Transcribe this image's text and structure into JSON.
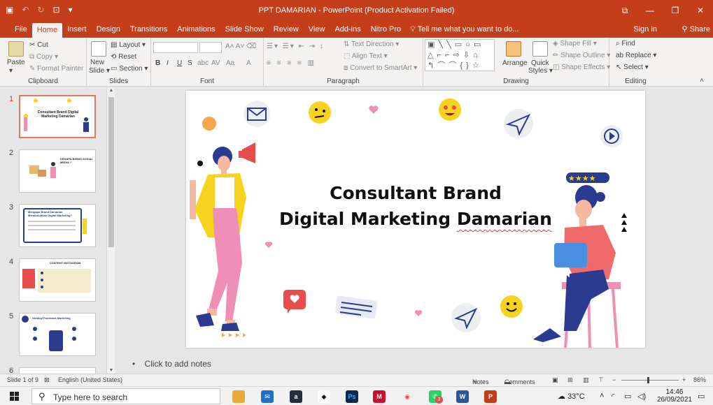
{
  "window": {
    "title": "PPT DAMARIAN  -  PowerPoint (Product Activation Failed)",
    "sign_in": "Sign in",
    "share": "Share"
  },
  "tabs": [
    "File",
    "Home",
    "Insert",
    "Design",
    "Transitions",
    "Animations",
    "Slide Show",
    "Review",
    "View",
    "Add-ins",
    "Nitro Pro"
  ],
  "active_tab": "Home",
  "tell_me": "Tell me what you want to do...",
  "ribbon": {
    "clipboard": {
      "label": "Clipboard",
      "paste": "Paste",
      "cut": "Cut",
      "copy": "Copy",
      "format_painter": "Format Painter"
    },
    "slides": {
      "label": "Slides",
      "new_slide_1": "New",
      "new_slide_2": "Slide",
      "layout": "Layout",
      "reset": "Reset",
      "section": "Section"
    },
    "font": {
      "label": "Font",
      "bold": "B",
      "italic": "I",
      "underline": "U",
      "strike": "S",
      "shadow": "abc",
      "spacing": "AV",
      "case": "Aa",
      "color": "A"
    },
    "paragraph": {
      "label": "Paragraph",
      "text_direction": "Text Direction",
      "align_text": "Align Text",
      "smartart": "Convert to SmartArt"
    },
    "drawing": {
      "label": "Drawing",
      "arrange": "Arrange",
      "quick_styles_1": "Quick",
      "quick_styles_2": "Styles",
      "shape_fill": "Shape Fill",
      "shape_outline": "Shape Outline",
      "shape_effects": "Shape Effects"
    },
    "editing": {
      "label": "Editing",
      "find": "Find",
      "replace": "Replace",
      "select": "Select"
    }
  },
  "thumbnails": [
    {
      "num": "1",
      "selected": true,
      "title": "Consultant Brand Digital Marketing Damarian"
    },
    {
      "num": "2",
      "selected": false,
      "title": "KENAPA BISNIS SOSIAL MEDIA ?"
    },
    {
      "num": "3",
      "selected": false,
      "title": "Mengapa Brand Damarian Membutuhkan Digital Marketing?"
    },
    {
      "num": "4",
      "selected": false,
      "title": "CONTENT INSTAGRAM"
    },
    {
      "num": "5",
      "selected": false,
      "title": "Strategi Facebook Marketing"
    },
    {
      "num": "6",
      "selected": false,
      "title": ""
    }
  ],
  "slide": {
    "title_line1": "Consultant Brand",
    "title_line2_a": "Digital Marketing ",
    "title_line2_b": "Damarian"
  },
  "notes_placeholder": "Click to add notes",
  "status": {
    "slide_count": "Slide 1 of 9",
    "language": "English (United States)",
    "notes": "Notes",
    "comments": "Comments",
    "zoom": "86%"
  },
  "taskbar": {
    "search_placeholder": "Type here to search",
    "temperature": "33°C",
    "time": "14:46",
    "date": "26/09/2021",
    "badge": "3"
  },
  "colors": {
    "accent": "#c43e1c",
    "ribbon_bg": "#f3f2f1",
    "slide_yellow": "#f6d31e",
    "slide_pink": "#f08fb6",
    "slide_navy": "#2b3b8f"
  }
}
